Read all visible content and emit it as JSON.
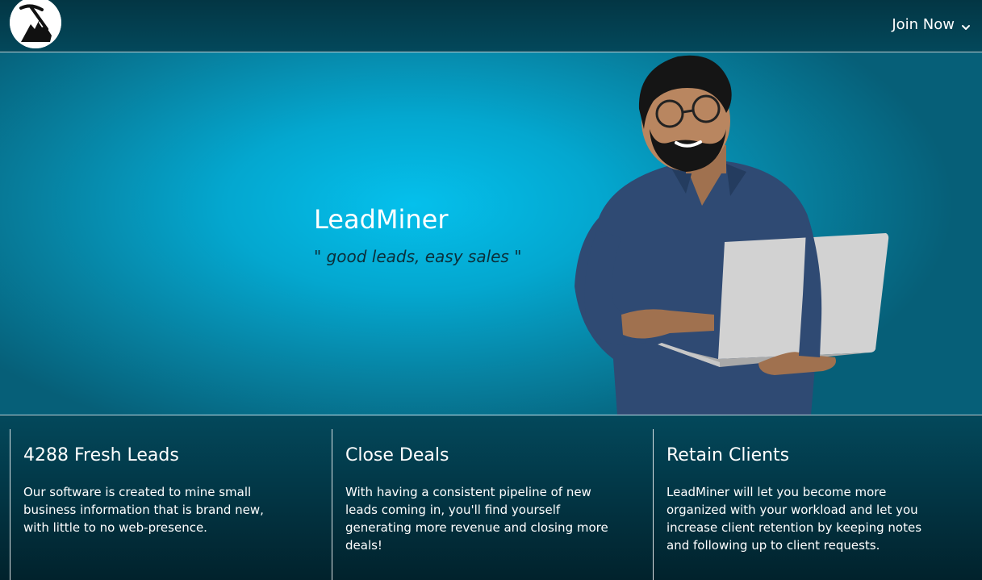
{
  "header": {
    "logo_icon": "pickaxe-mountain-icon",
    "join_label": "Join Now",
    "join_icon": "chevron-down-icon"
  },
  "hero": {
    "title": "LeadMiner",
    "tagline": "\" good leads, easy sales \"",
    "illustration_icon": "man-with-laptop-illustration"
  },
  "features": [
    {
      "title": "4288 Fresh Leads",
      "body": "Our software is created to mine small business information that is brand new, with little to no web-presence."
    },
    {
      "title": "Close Deals",
      "body": "With having a consistent pipeline of new leads coming in, you'll find yourself generating more revenue and closing more deals!"
    },
    {
      "title": "Retain Clients",
      "body": "LeadMiner will let you become more organized with your workload and let you increase client retention by keeping notes and following up to client requests."
    }
  ],
  "colors": {
    "hero_center": "#05c0ec",
    "page_dark": "#012a36",
    "tagline": "#0b2f3a"
  }
}
